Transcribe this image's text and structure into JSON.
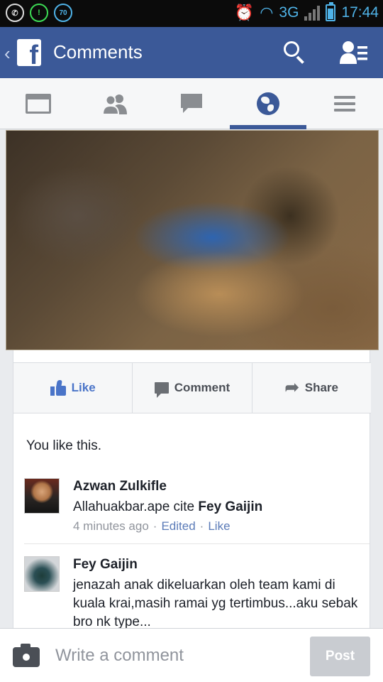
{
  "status_bar": {
    "notif_count": "70",
    "network": "3G",
    "time": "17:44",
    "battery_level": 0.75,
    "icons": [
      "whatsapp-icon",
      "notification-icon",
      "count-badge-icon",
      "alarm-icon",
      "wifi-icon",
      "signal-icon",
      "battery-icon"
    ]
  },
  "header": {
    "title": "Comments",
    "logo_letter": "f",
    "back_glyph": "‹",
    "icons": [
      "back-icon",
      "facebook-logo-icon",
      "search-icon",
      "friend-requests-icon"
    ],
    "color": "#3b5998"
  },
  "tabs": [
    {
      "name": "news-feed-icon",
      "active": false
    },
    {
      "name": "friends-icon",
      "active": false
    },
    {
      "name": "messages-icon",
      "active": false
    },
    {
      "name": "notifications-globe-icon",
      "active": true
    },
    {
      "name": "menu-icon",
      "active": false
    }
  ],
  "actions": {
    "like": "Like",
    "comment": "Comment",
    "share": "Share"
  },
  "likes_summary": "You like this.",
  "comments": [
    {
      "author": "Azwan Zulkifle",
      "text": "Allahuakbar.ape cite ",
      "mention": "Fey Gaijin",
      "time": "4 minutes ago",
      "edited": "Edited",
      "like": "Like"
    },
    {
      "author": "Fey Gaijin",
      "text": "jenazah anak dikeluarkan oleh team kami di kuala krai,masih ramai yg tertimbus...aku sebak bro nk type..."
    }
  ],
  "composer": {
    "placeholder": "Write a comment",
    "post_label": "Post"
  }
}
